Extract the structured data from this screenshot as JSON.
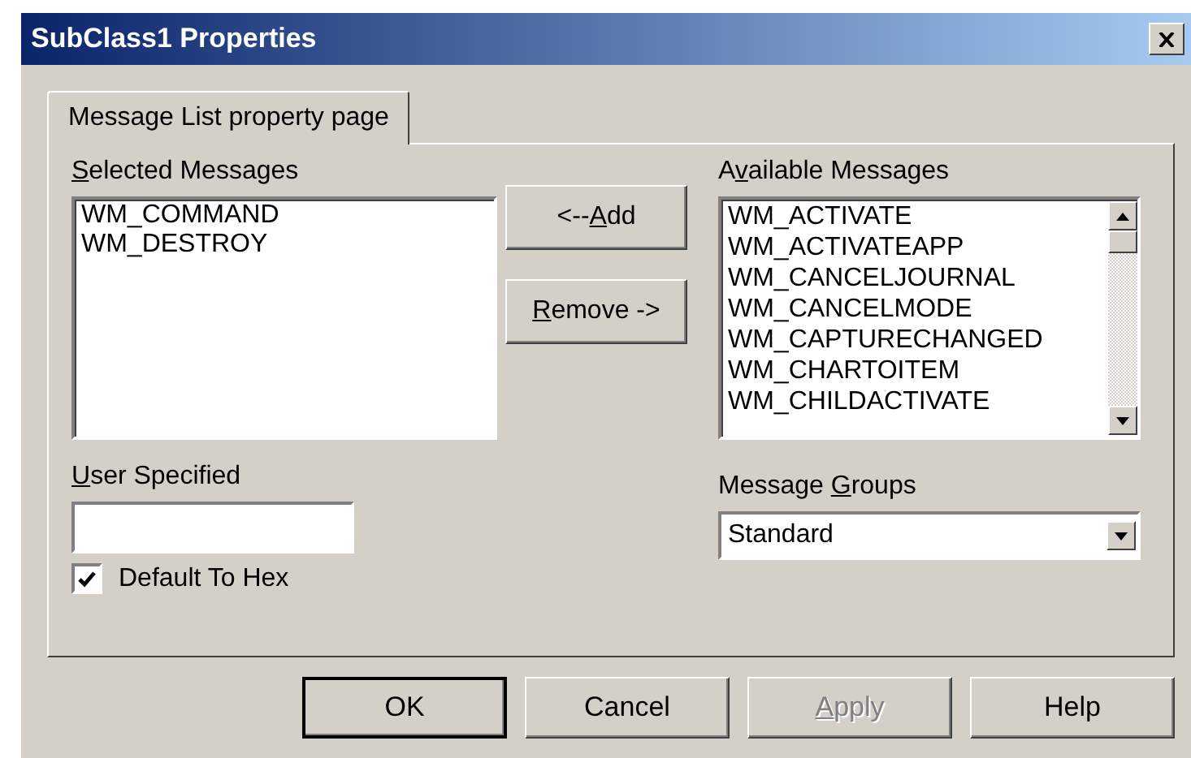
{
  "window": {
    "title": "SubClass1 Properties"
  },
  "tabs": [
    {
      "label": {
        "after": "Message List property page"
      },
      "selected": true
    }
  ],
  "selected_messages": {
    "label": {
      "key": "S",
      "after": "elected Messages"
    },
    "items": [
      "WM_COMMAND",
      "WM_DESTROY"
    ]
  },
  "user_specified": {
    "label": {
      "key": "U",
      "after": "ser Specified"
    }
  },
  "default_to_hex": {
    "label": "Default To Hex",
    "checked": true
  },
  "move_buttons": [
    {
      "label": {
        "before": "<--",
        "key": "A",
        "after": "dd"
      }
    },
    {
      "label": {
        "key": "R",
        "after": "emove ->"
      }
    }
  ],
  "available_messages": {
    "label": {
      "before": "A",
      "key": "v",
      "after": "ailable Messages"
    },
    "items": [
      "WM_ACTIVATE",
      "WM_ACTIVATEAPP",
      "WM_CANCELJOURNAL",
      "WM_CANCELMODE",
      "WM_CAPTURECHANGED",
      "WM_CHARTOITEM",
      "WM_CHILDACTIVATE"
    ]
  },
  "message_groups": {
    "label": {
      "before": "Message ",
      "key": "G",
      "after": "roups"
    },
    "value": "Standard"
  },
  "buttons": [
    {
      "label": {
        "after": "OK"
      },
      "default": true,
      "disabled": false
    },
    {
      "label": {
        "after": "Cancel"
      },
      "default": false,
      "disabled": false
    },
    {
      "label": {
        "key": "A",
        "after": "pply"
      },
      "default": false,
      "disabled": true
    },
    {
      "label": {
        "after": "Help"
      },
      "default": false,
      "disabled": false
    }
  ]
}
